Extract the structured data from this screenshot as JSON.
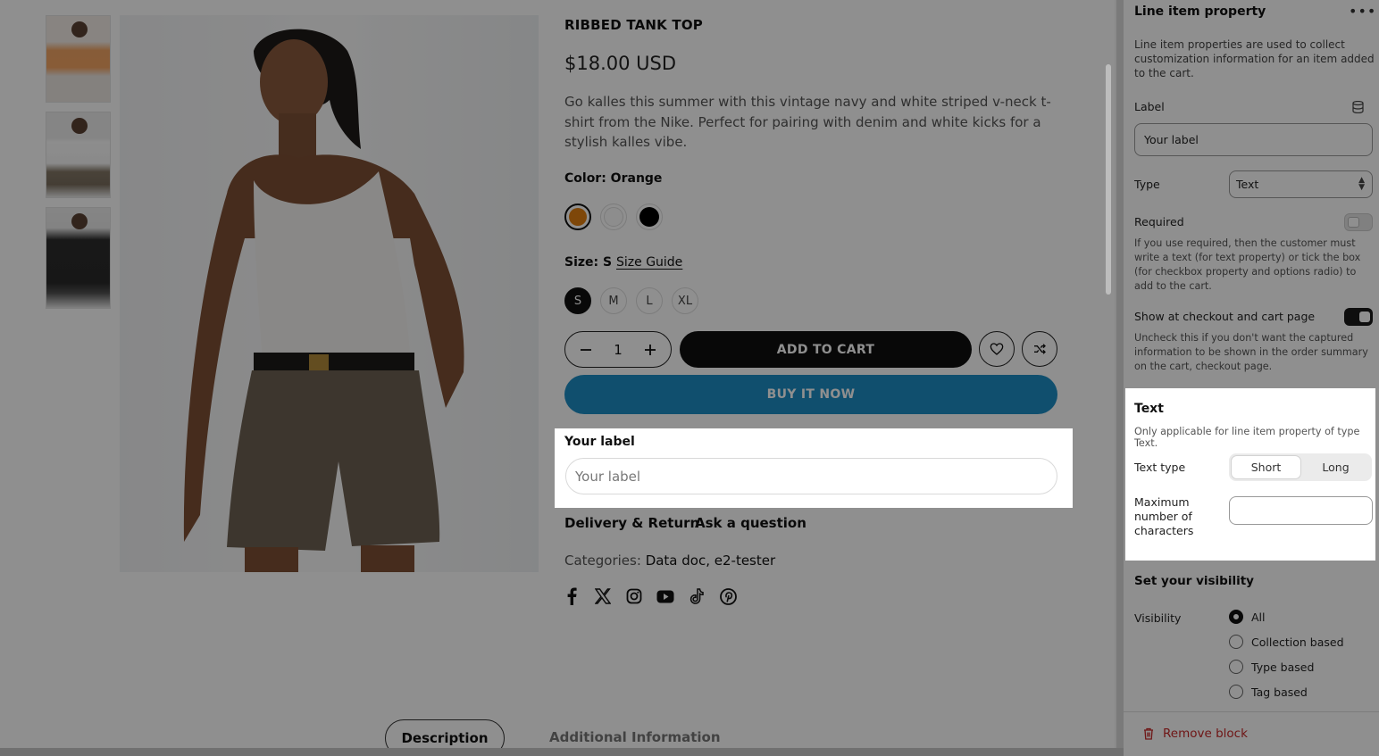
{
  "product": {
    "title": "RIBBED TANK TOP",
    "price": "$18.00 USD",
    "description": "Go kalles this summer with this vintage navy and white striped v-neck t-shirt from the Nike. Perfect for pairing with denim and white kicks for a stylish kalles vibe.",
    "color_label": "Color: Orange",
    "colors": [
      "#e07f10",
      "#fbfbfb",
      "#000000"
    ],
    "size_label": "Size: S",
    "size_guide": "Size Guide",
    "sizes": [
      "S",
      "M",
      "L",
      "XL"
    ],
    "quantity": "1",
    "add_to_cart": "ADD TO CART",
    "buy_now": "BUY IT NOW",
    "property_label": "Your label",
    "property_placeholder": "Your label",
    "links": [
      "Delivery & Return",
      "Ask a question"
    ],
    "categories_prefix": "Categories:",
    "categories": "Data doc, e2-tester",
    "socials": [
      "facebook-icon",
      "x-icon",
      "instagram-icon",
      "youtube-icon",
      "tiktok-icon",
      "pinterest-icon"
    ],
    "tabs": [
      "Description",
      "Additional Information"
    ]
  },
  "sidebar": {
    "title": "Line item property",
    "help": "Line item properties are used to collect customization information for an item added to the cart.",
    "label_field_label": "Label",
    "label_value": "Your label",
    "type_label": "Type",
    "type_value": "Text",
    "required_label": "Required",
    "required_help": "If you use required, then the customer must write a text (for text property) or tick the box (for checkbox property and options radio) to add to the cart.",
    "show_label": "Show at checkout and cart page",
    "show_help": "Uncheck this if you don't want the captured information to be shown in the order summary on the cart, checkout page.",
    "text_section": {
      "title": "Text",
      "subtitle": "Only applicable for line item property of type Text.",
      "text_type_label": "Text type",
      "options": [
        "Short",
        "Long"
      ],
      "max_label": "Maximum number of characters",
      "max_value": ""
    },
    "visibility": {
      "title": "Set your visibility",
      "label": "Visibility",
      "options": [
        "All",
        "Collection based",
        "Type based",
        "Tag based"
      ]
    },
    "remove": "Remove block"
  },
  "colors": {
    "accent_blue": "#1e8dc4",
    "danger": "#c62828"
  }
}
